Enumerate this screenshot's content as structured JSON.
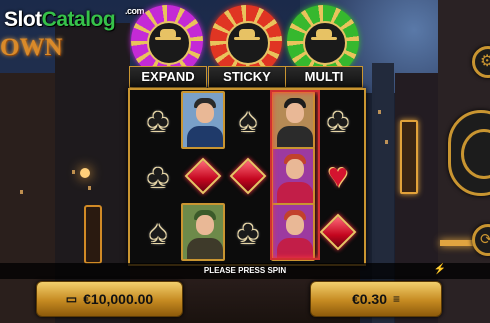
{
  "watermark": {
    "slot": "Slot",
    "catalog": "Catalog",
    "com": ".com"
  },
  "game_title": "OWN",
  "features": [
    {
      "label": "EXPAND",
      "color": "#c42ad6",
      "icon": "gold-chip-icon"
    },
    {
      "label": "STICKY",
      "color": "#e03523",
      "icon": "gold-chip-icon"
    },
    {
      "label": "MULTI",
      "color": "#36b82e",
      "icon": "gold-chip-icon"
    }
  ],
  "reels": {
    "grid": [
      [
        "club",
        "man-suit",
        "spade",
        "mobster",
        "club"
      ],
      [
        "club",
        "ruby",
        "ruby",
        "lady",
        "heart"
      ],
      [
        "spade",
        "green-man",
        "club",
        "lady",
        "ruby"
      ]
    ]
  },
  "status": {
    "message": "PLEASE PRESS SPIN"
  },
  "balance": {
    "value": "€10,000.00",
    "icon": "wallet-icon"
  },
  "bet": {
    "value": "€0.30",
    "icon": "coin-stack-icon"
  },
  "colors": {
    "gold": "#c99531",
    "highlight": "#d03030"
  }
}
